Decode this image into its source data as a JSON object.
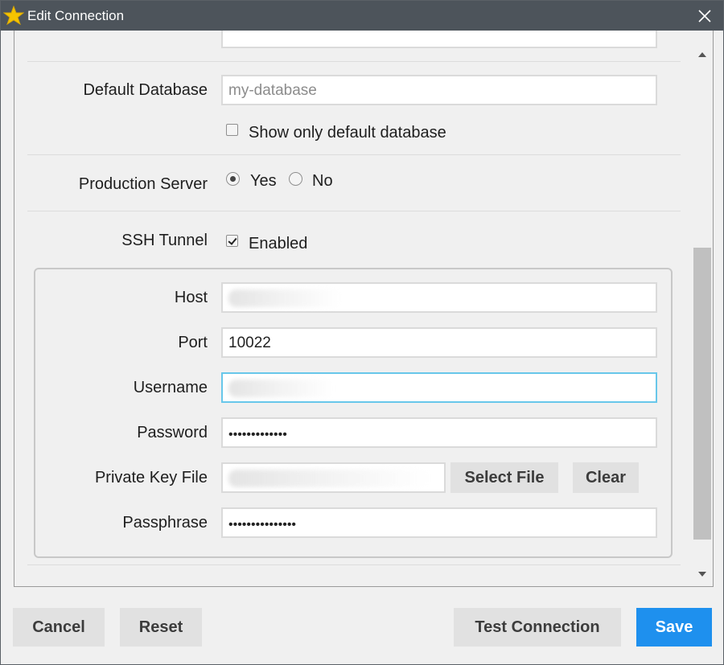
{
  "window": {
    "title": "Edit Connection"
  },
  "form": {
    "default_database": {
      "label": "Default Database",
      "placeholder": "my-database"
    },
    "show_only_default": {
      "label": "Show only default database",
      "checked": false
    },
    "production_server": {
      "label": "Production Server",
      "options": [
        "Yes",
        "No"
      ],
      "selected": "Yes"
    },
    "ssh_tunnel": {
      "label": "SSH Tunnel",
      "enabled_label": "Enabled",
      "enabled": true
    },
    "ssh": {
      "host_label": "Host",
      "port_label": "Port",
      "port_value": "10022",
      "username_label": "Username",
      "password_label": "Password",
      "password_value": "•••••••••••••",
      "private_key_label": "Private Key File",
      "select_file_label": "Select File",
      "clear_label": "Clear",
      "passphrase_label": "Passphrase",
      "passphrase_value": "•••••••••••••••"
    }
  },
  "footer": {
    "cancel": "Cancel",
    "reset": "Reset",
    "test_connection": "Test Connection",
    "save": "Save"
  },
  "colors": {
    "titlebar": "#4d545b",
    "primary_button": "#1e90ee",
    "focus_border": "#68c7ea",
    "app_icon": "#f5c400"
  },
  "icons": {
    "app": "star-icon",
    "close": "close-icon"
  }
}
